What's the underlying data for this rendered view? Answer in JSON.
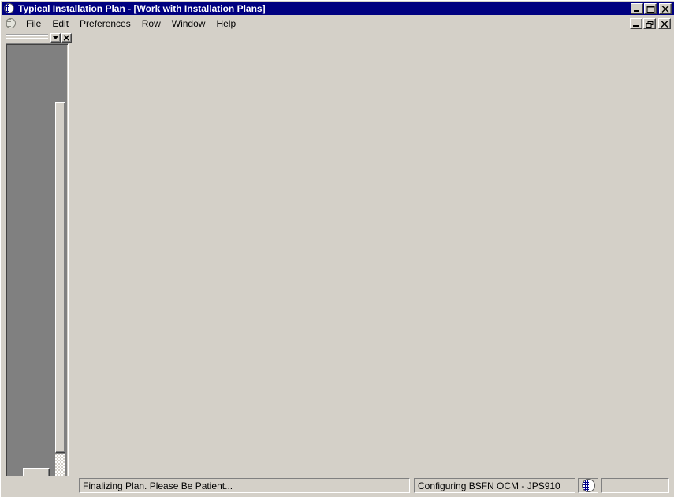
{
  "window": {
    "title": "Typical Installation Plan - [Work with Installation Plans]",
    "icon": "globe-icon",
    "controls": {
      "minimize_label": "Minimize",
      "maximize_label": "Maximize",
      "close_label": "Close"
    }
  },
  "mdi_child": {
    "icon": "globe-icon",
    "controls": {
      "minimize_label": "Minimize",
      "restore_label": "Restore",
      "close_label": "Close"
    }
  },
  "menubar": {
    "items": [
      {
        "label": "File"
      },
      {
        "label": "Edit"
      },
      {
        "label": "Preferences"
      },
      {
        "label": "Row"
      },
      {
        "label": "Window"
      },
      {
        "label": "Help"
      }
    ]
  },
  "left_panel": {
    "caption_dropdown_icon": "chevron-down-icon",
    "caption_close_icon": "close-icon",
    "scrollbar": {
      "orientation": "vertical",
      "thumb_position_percent": 0
    },
    "bottom_button_label": ""
  },
  "statusbar": {
    "panes": [
      {
        "name": "progress-message",
        "text": "Finalizing Plan. Please Be Patient..."
      },
      {
        "name": "task-message",
        "text": "Configuring BSFN OCM - JPS910"
      },
      {
        "name": "activity-icon",
        "text": "",
        "icon": "globe-icon"
      },
      {
        "name": "spare-pane",
        "text": ""
      }
    ]
  },
  "colors": {
    "titlebar": "#000080",
    "titlebar_text": "#ffffff",
    "face": "#d4d0c8",
    "panel_fill": "#808080",
    "shadow": "#808080",
    "dark_shadow": "#404040",
    "highlight": "#ffffff",
    "globe_blue": "#00008b"
  }
}
